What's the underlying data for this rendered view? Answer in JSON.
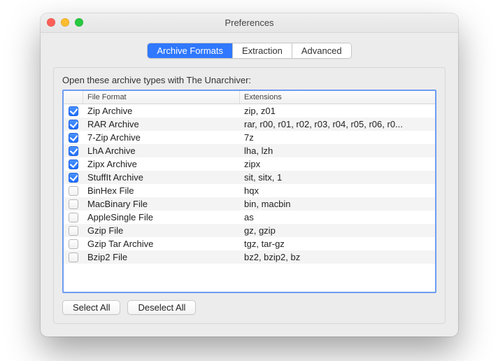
{
  "window": {
    "title": "Preferences"
  },
  "tabs": [
    {
      "label": "Archive Formats",
      "active": true
    },
    {
      "label": "Extraction",
      "active": false
    },
    {
      "label": "Advanced",
      "active": false
    }
  ],
  "panel": {
    "caption": "Open these archive types with The Unarchiver:",
    "columns": {
      "file_format": "File Format",
      "extensions": "Extensions"
    },
    "rows": [
      {
        "checked": true,
        "format": "Zip Archive",
        "ext": "zip, z01"
      },
      {
        "checked": true,
        "format": "RAR Archive",
        "ext": "rar, r00, r01, r02, r03, r04, r05, r06, r0..."
      },
      {
        "checked": true,
        "format": "7-Zip Archive",
        "ext": "7z"
      },
      {
        "checked": true,
        "format": "LhA Archive",
        "ext": "lha, lzh"
      },
      {
        "checked": true,
        "format": "Zipx Archive",
        "ext": "zipx"
      },
      {
        "checked": true,
        "format": "StuffIt Archive",
        "ext": "sit, sitx, 1"
      },
      {
        "checked": false,
        "format": "BinHex File",
        "ext": "hqx"
      },
      {
        "checked": false,
        "format": "MacBinary File",
        "ext": "bin, macbin"
      },
      {
        "checked": false,
        "format": "AppleSingle File",
        "ext": "as"
      },
      {
        "checked": false,
        "format": "Gzip File",
        "ext": "gz, gzip"
      },
      {
        "checked": false,
        "format": "Gzip Tar Archive",
        "ext": "tgz, tar-gz"
      },
      {
        "checked": false,
        "format": "Bzip2 File",
        "ext": "bz2, bzip2, bz"
      }
    ],
    "buttons": {
      "select_all": "Select All",
      "deselect_all": "Deselect All"
    }
  }
}
